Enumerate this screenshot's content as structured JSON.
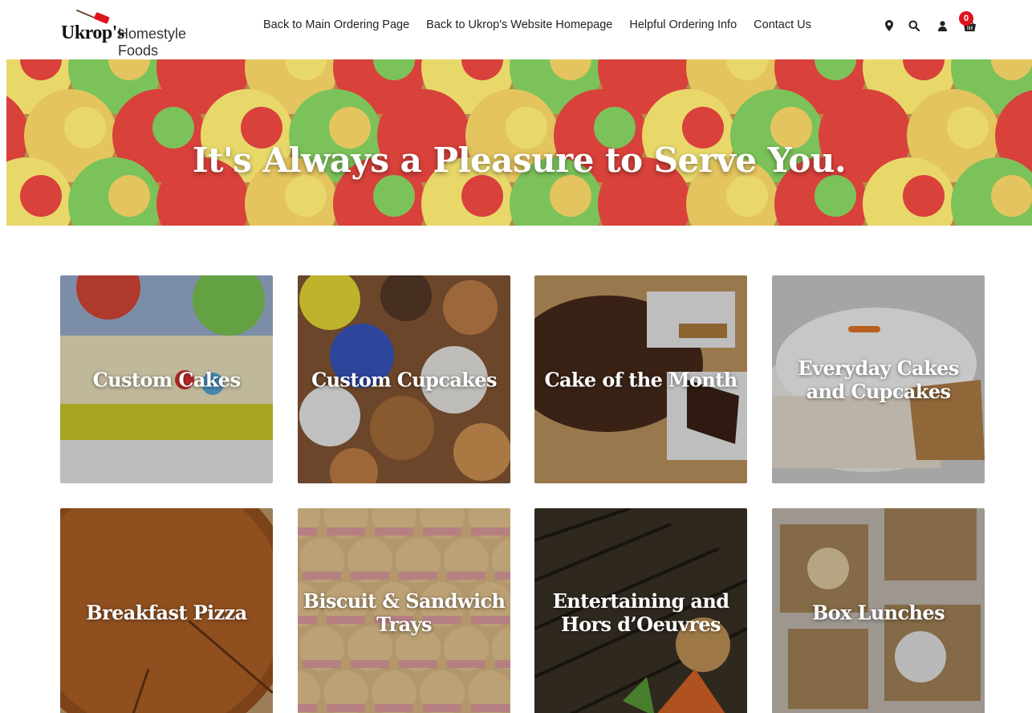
{
  "brand": {
    "name": "Ukrop's",
    "tagline": "Homestyle Foods",
    "accent": "#e0131d"
  },
  "nav": {
    "items": [
      {
        "label": "Back to Main Ordering Page"
      },
      {
        "label": "Back to Ukrop's Website Homepage"
      },
      {
        "label": "Helpful Ordering Info"
      },
      {
        "label": "Contact Us"
      }
    ]
  },
  "header_icons": {
    "location": "map-marker-icon",
    "search": "search-icon",
    "account": "user-icon",
    "cart": "basket-icon",
    "cart_count": "0"
  },
  "hero": {
    "title": "It's Always a Pleasure to Serve You."
  },
  "categories": [
    {
      "label": "Custom Cakes"
    },
    {
      "label": "Custom Cupcakes"
    },
    {
      "label": "Cake of the Month"
    },
    {
      "label": "Everyday Cakes and Cupcakes"
    },
    {
      "label": "Breakfast Pizza"
    },
    {
      "label": "Biscuit & Sandwich Trays"
    },
    {
      "label": "Entertaining and Hors d’Oeuvres"
    },
    {
      "label": "Box Lunches"
    }
  ]
}
